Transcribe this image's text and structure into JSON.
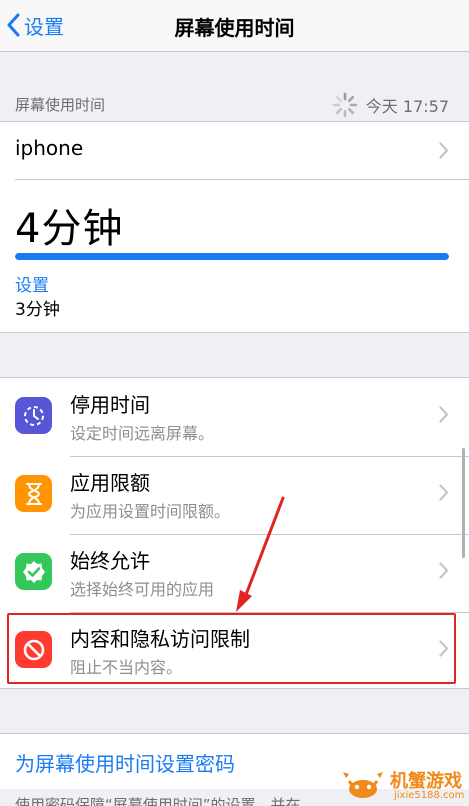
{
  "nav": {
    "back_label": "设置",
    "title": "屏幕使用时间"
  },
  "summary": {
    "section_label": "屏幕使用时间",
    "timestamp": "今天 17:57",
    "device_name": "iphone",
    "total_time": "4分钟",
    "usage_fraction": 1.0,
    "category_name": "设置",
    "category_time": "3分钟"
  },
  "options": [
    {
      "title": "停用时间",
      "subtitle": "设定时间远离屏幕。",
      "icon": "downtime-icon",
      "color": "#5856d6"
    },
    {
      "title": "应用限额",
      "subtitle": "为应用设置时间限额。",
      "icon": "hourglass-icon",
      "color": "#ff9500"
    },
    {
      "title": "始终允许",
      "subtitle": "选择始终可用的应用",
      "icon": "checkmark-badge-icon",
      "color": "#34c759"
    },
    {
      "title": "内容和隐私访问限制",
      "subtitle": "阻止不当内容。",
      "icon": "restriction-icon",
      "color": "#ff3b30"
    }
  ],
  "passcode": {
    "link_label": "为屏幕使用时间设置密码",
    "footnote": "使用密码保障“屏幕使用时间”的设置，并在"
  },
  "watermark": {
    "name": "机蟹游戏",
    "url": "jixie5188.com"
  },
  "colors": {
    "accent": "#1a7cf5",
    "highlight": "#e02424",
    "background": "#efeff4"
  }
}
